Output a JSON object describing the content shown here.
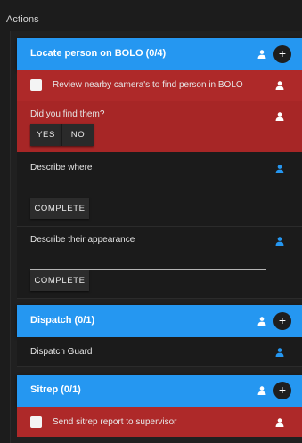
{
  "panel": {
    "title": "Actions"
  },
  "colors": {
    "header": "#2597f1",
    "alert_row": "#ae2929",
    "user_icon_blue": "#2597f1"
  },
  "sections": [
    {
      "title": "Locate person on BOLO (0/4)",
      "items": [
        {
          "type": "checkbox",
          "label": "Review nearby camera's to find person in BOLO",
          "checked": false,
          "assignee_icon": "person-icon"
        },
        {
          "type": "question",
          "label": "Did you find them?",
          "yes": "YES",
          "no": "NO",
          "assignee_icon": "person-icon"
        },
        {
          "type": "text-input",
          "label": "Describe where",
          "value": "",
          "button": "COMPLETE",
          "assignee_icon": "person-icon"
        },
        {
          "type": "text-input",
          "label": "Describe their appearance",
          "value": "",
          "button": "COMPLETE",
          "assignee_icon": "person-icon"
        }
      ]
    },
    {
      "title": "Dispatch (0/1)",
      "items": [
        {
          "type": "assignment",
          "label": "Dispatch Guard",
          "assignee_icon": "person-icon"
        }
      ]
    },
    {
      "title": "Sitrep (0/1)",
      "items": [
        {
          "type": "checkbox",
          "label": "Send sitrep report to supervisor",
          "checked": false,
          "assignee_icon": "person-icon"
        }
      ]
    }
  ]
}
